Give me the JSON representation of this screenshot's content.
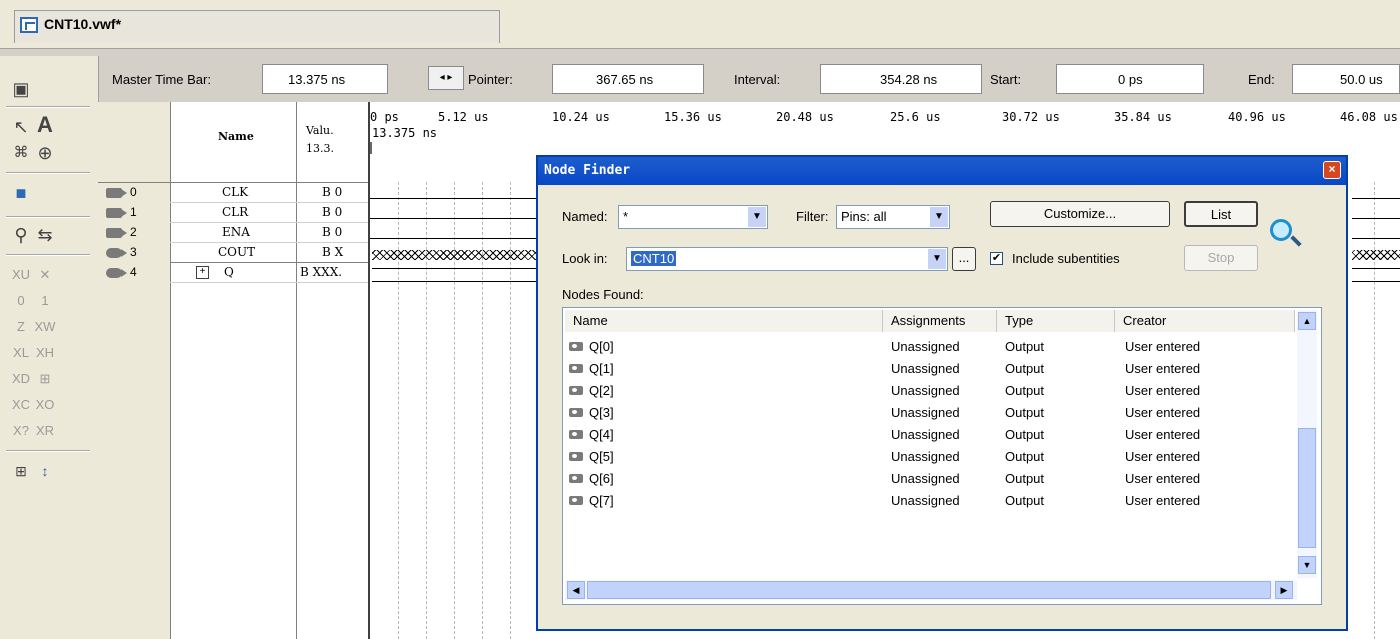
{
  "document_tab": {
    "title": "CNT10.vwf*"
  },
  "time_bar": {
    "master_label": "Master Time Bar:",
    "master_value": "13.375 ns",
    "pointer_label": "Pointer:",
    "pointer_value": "367.65 ns",
    "interval_label": "Interval:",
    "interval_value": "354.28 ns",
    "start_label": "Start:",
    "start_value": "0 ps",
    "end_label": "End:",
    "end_value": "50.0 us"
  },
  "node_table": {
    "name_header": "Name",
    "value_header_1": "Valu.",
    "value_header_2": "13.3.",
    "rows": [
      {
        "index": "0",
        "name": "CLK",
        "value": "B 0"
      },
      {
        "index": "1",
        "name": "CLR",
        "value": "B 0"
      },
      {
        "index": "2",
        "name": "ENA",
        "value": "B 0"
      },
      {
        "index": "3",
        "name": "COUT",
        "value": "B X"
      },
      {
        "index": "4",
        "name": "Q",
        "value": "B XXX."
      }
    ],
    "expand_symbol": "+"
  },
  "waveform": {
    "ticks": [
      "0 ps",
      "5.12 us",
      "10.24 us",
      "15.36 us",
      "20.48 us",
      "25.6 us",
      "30.72 us",
      "35.84 us",
      "40.96 us",
      "46.08 us"
    ],
    "master_marker_label": "13.375 ns"
  },
  "node_finder": {
    "title": "Node Finder",
    "named_label": "Named:",
    "named_value": "*",
    "filter_label": "Filter:",
    "filter_value": "Pins: all",
    "customize_button": "Customize...",
    "list_button": "List",
    "look_in_label": "Look in:",
    "look_in_value": "CNT10",
    "browse_button": "...",
    "include_subentities_label": "Include subentities",
    "include_subentities_checked": true,
    "stop_button": "Stop",
    "nodes_found_label": "Nodes Found:",
    "columns": [
      "Name",
      "Assignments",
      "Type",
      "Creator"
    ],
    "nodes": [
      {
        "name": "Q[0]",
        "assignments": "Unassigned",
        "type": "Output",
        "creator": "User entered"
      },
      {
        "name": "Q[1]",
        "assignments": "Unassigned",
        "type": "Output",
        "creator": "User entered"
      },
      {
        "name": "Q[2]",
        "assignments": "Unassigned",
        "type": "Output",
        "creator": "User entered"
      },
      {
        "name": "Q[3]",
        "assignments": "Unassigned",
        "type": "Output",
        "creator": "User entered"
      },
      {
        "name": "Q[4]",
        "assignments": "Unassigned",
        "type": "Output",
        "creator": "User entered"
      },
      {
        "name": "Q[5]",
        "assignments": "Unassigned",
        "type": "Output",
        "creator": "User entered"
      },
      {
        "name": "Q[6]",
        "assignments": "Unassigned",
        "type": "Output",
        "creator": "User entered"
      },
      {
        "name": "Q[7]",
        "assignments": "Unassigned",
        "type": "Output",
        "creator": "User entered"
      }
    ]
  },
  "colors": {
    "title_bar": "#0848c8",
    "selection": "#316ac5",
    "scrollbar": "#c1d3fb"
  }
}
